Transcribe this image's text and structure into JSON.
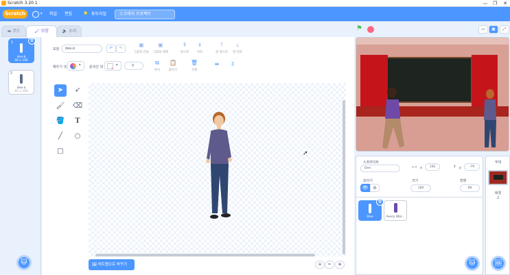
{
  "window": {
    "title": "Scratch 3.20.1",
    "controls": [
      "—",
      "❐",
      "✕"
    ]
  },
  "menubar": {
    "logo": "Scratch",
    "file": "파일",
    "edit": "편집",
    "tutorials": "튜토리얼",
    "project_title": "스크래치 프로젝트"
  },
  "tabs": [
    {
      "label": "코드"
    },
    {
      "label": "모양"
    },
    {
      "label": "소리"
    }
  ],
  "costumes": [
    {
      "num": "1",
      "name": "dee-b",
      "size": "46 x 192",
      "selected": true
    },
    {
      "num": "2",
      "name": "dee-a",
      "size": "45 x 190",
      "selected": false
    }
  ],
  "editor": {
    "costume_label": "모양",
    "costume_name": "dee-b",
    "group": "그룹화 만들",
    "ungroup": "그룹화 해제",
    "forward": "앞으로",
    "backward": "뒤로",
    "front": "맨 앞으로",
    "back": "맨 뒤로",
    "fill_label": "채우기 색",
    "outline_label": "윤곽선 색",
    "outline_value": "0",
    "copy": "복사",
    "paste": "붙이기",
    "delete": "삭제",
    "convert_bitmap": "비트맵으로 바꾸기",
    "zoom_reset": "="
  },
  "sprite_info": {
    "sprite_label": "스프라이트",
    "sprite_name": "Dee",
    "x_label": "x",
    "x_value": "102",
    "y_label": "y",
    "y_value": "-79",
    "show_label": "보이기",
    "size_label": "크기",
    "size_value": "100",
    "direction_label": "방향",
    "direction_value": "90"
  },
  "sprites": [
    {
      "name": "Dee",
      "selected": true
    },
    {
      "name": "Avery Wal...",
      "selected": false
    }
  ],
  "stage_panel": {
    "title": "무대",
    "backdrop_label": "배경",
    "backdrop_count": "2"
  },
  "colors": {
    "primary": "#4c97ff",
    "stop": "#ff6680",
    "flag": "#4cbf56"
  }
}
